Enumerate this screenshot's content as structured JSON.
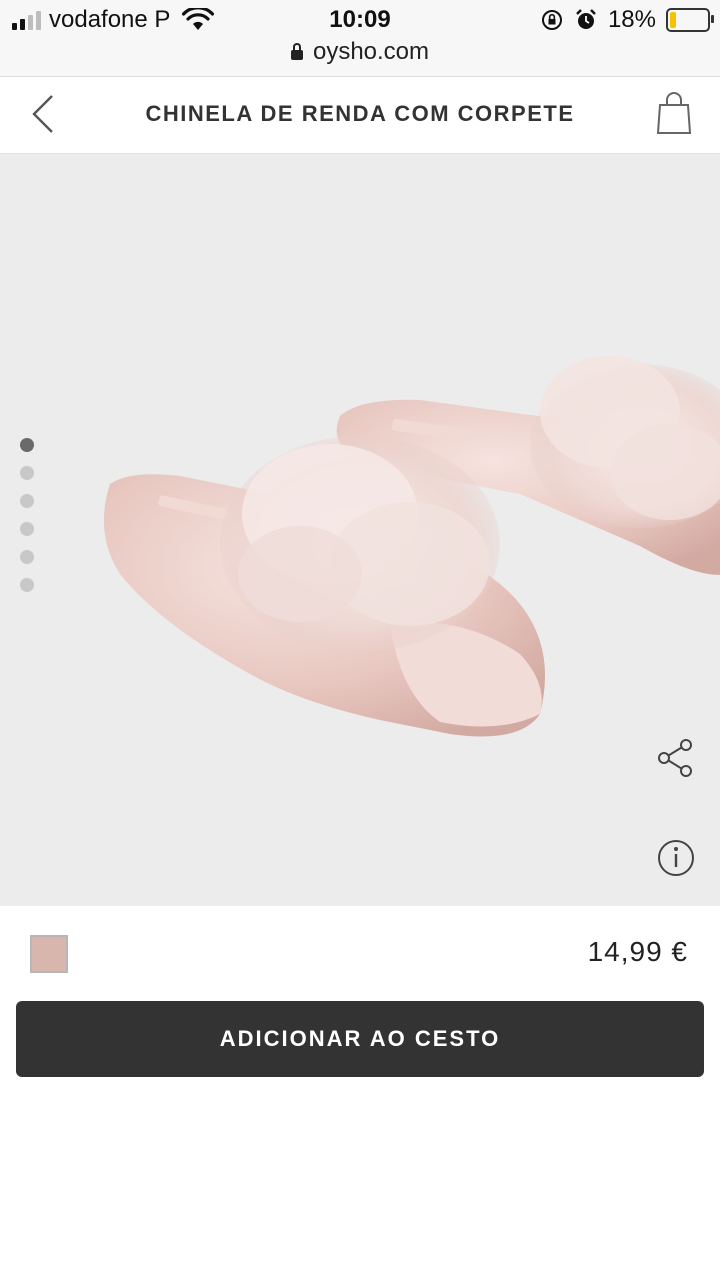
{
  "status_bar": {
    "carrier": "vodafone P",
    "time": "10:09",
    "battery_percent": "18%",
    "battery_level": 0.18,
    "url": "oysho.com",
    "icons": [
      "signal-icon",
      "wifi-icon",
      "orientation-lock-icon",
      "alarm-icon",
      "battery-icon",
      "lock-icon"
    ]
  },
  "header": {
    "title": "CHINELA DE RENDA COM CORPETE",
    "back_icon": "chevron-left-icon",
    "cart_icon": "shopping-bag-icon"
  },
  "gallery": {
    "image": "pink satin slippers with fluffy feathers",
    "dot_count": 6,
    "active_index": 0,
    "share_icon": "share-icon",
    "info_icon": "info-icon"
  },
  "product": {
    "color_swatch": "#d9b6ad",
    "price": "14,99 €",
    "add_to_cart_label": "ADICIONAR AO CESTO"
  },
  "colors": {
    "button_bg": "#333333",
    "gallery_bg": "#ececec",
    "battery_fill": "#f5c400"
  }
}
